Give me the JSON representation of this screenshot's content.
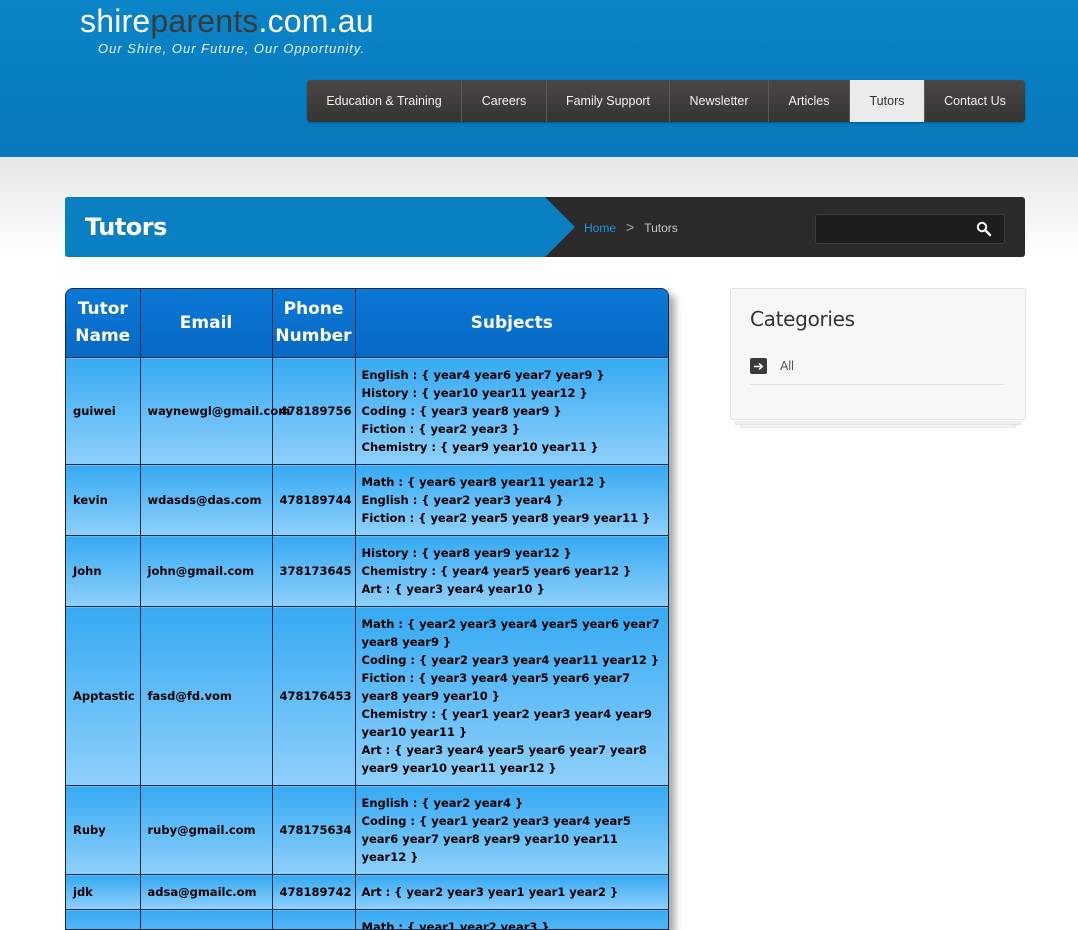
{
  "logo": {
    "part1": "shire",
    "part2": "parents",
    "part3": ".com.au"
  },
  "tagline": "Our Shire, Our Future, Our Opportunity.",
  "nav": [
    {
      "label": "Education & Training",
      "active": false
    },
    {
      "label": "Careers",
      "active": false
    },
    {
      "label": "Family Support",
      "active": false
    },
    {
      "label": "Newsletter",
      "active": false
    },
    {
      "label": "Articles",
      "active": false
    },
    {
      "label": "Tutors",
      "active": true
    },
    {
      "label": "Contact Us",
      "active": false
    }
  ],
  "page_title": "Tutors",
  "breadcrumb": {
    "home": "Home",
    "separator": ">",
    "current": "Tutors"
  },
  "search": {
    "value": "",
    "placeholder": ""
  },
  "table": {
    "headers": {
      "name": "Tutor Name",
      "email": "Email",
      "phone": "Phone Number",
      "subjects": "Subjects"
    },
    "rows": [
      {
        "name": "guiwei",
        "email": "waynewgl@gmail.com",
        "phone": "478189756",
        "subjects": [
          "English : { year4 year6 year7 year9 }",
          "History : { year10 year11 year12 }",
          "Coding : { year3 year8 year9 }",
          "Fiction : { year2 year3 }",
          "Chemistry : { year9 year10 year11 }"
        ]
      },
      {
        "name": "kevin",
        "email": "wdasds@das.com",
        "phone": "478189744",
        "subjects": [
          "Math : { year6 year8 year11 year12 }",
          "English : { year2 year3 year4 }",
          "Fiction : { year2 year5 year8 year9 year11 }"
        ]
      },
      {
        "name": "John",
        "email": "john@gmail.com",
        "phone": "378173645",
        "subjects": [
          "History : { year8 year9 year12 }",
          "Chemistry : { year4 year5 year6 year12 }",
          "Art : { year3 year4 year10 }"
        ]
      },
      {
        "name": "Apptastic",
        "email": "fasd@fd.vom",
        "phone": "478176453",
        "subjects": [
          "Math : { year2 year3 year4 year5 year6 year7 year8 year9 }",
          "Coding : { year2 year3 year4 year11 year12 }",
          "Fiction : { year3 year4 year5 year6 year7 year8 year9 year10 }",
          "Chemistry : { year1 year2 year3 year4 year9 year10 year11 }",
          "Art : { year3 year4 year5 year6 year7 year8 year9 year10 year11 year12 }"
        ]
      },
      {
        "name": "Ruby",
        "email": "ruby@gmail.com",
        "phone": "478175634",
        "subjects": [
          "English : { year2 year4 }",
          "Coding : { year1 year2 year3 year4 year5 year6 year7 year8 year9 year10 year11 year12 }"
        ]
      },
      {
        "name": "jdk",
        "email": "adsa@gmailc.om",
        "phone": "478189742",
        "subjects": [
          "Art : { year2 year3 year1 year1 year2 }"
        ]
      },
      {
        "name": "",
        "email": "",
        "phone": "",
        "subjects": [
          "Math : { year1 year2 year3 }"
        ]
      }
    ]
  },
  "sidebar": {
    "title": "Categories",
    "items": [
      {
        "label": "All"
      }
    ]
  },
  "colors": {
    "brand_blue": "#0a7fc2",
    "nav_dark": "#3d3b38",
    "table_header": "#0a74d0",
    "table_cell": "#5ab7f4"
  }
}
